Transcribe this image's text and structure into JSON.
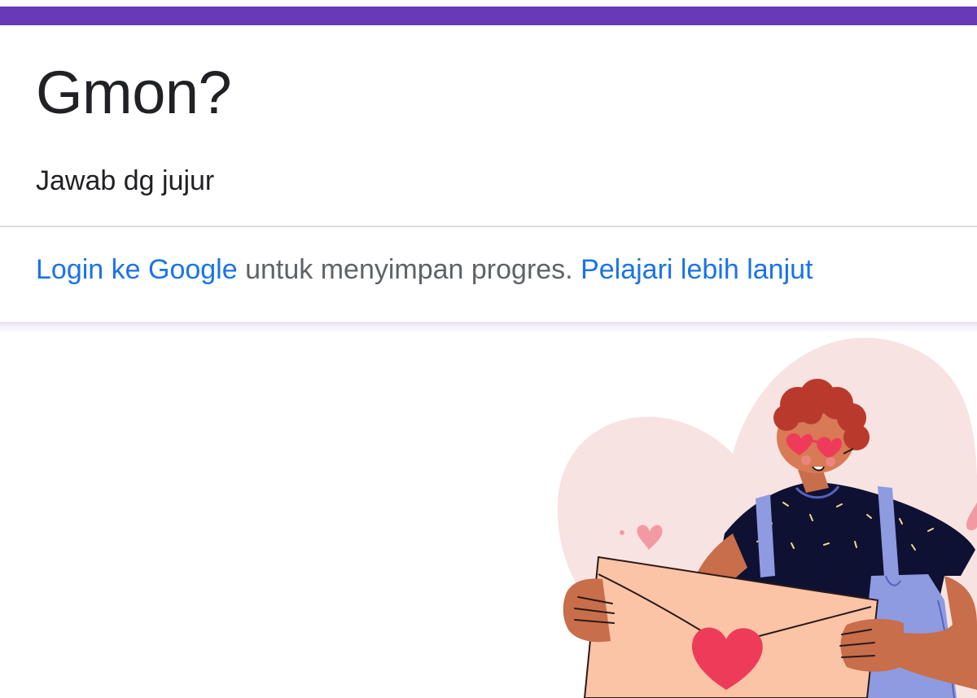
{
  "form": {
    "title": "Gmon?",
    "description": "Jawab dg jujur",
    "accent_color": "#673ab7"
  },
  "login_notice": {
    "login_link": "Login ke Google",
    "text": " untuk menyimpan progres. ",
    "learn_more_link": "Pelajari lebih lanjut",
    "link_color": "#1a73e8"
  },
  "illustration": {
    "subject": "person-holding-love-letter"
  }
}
